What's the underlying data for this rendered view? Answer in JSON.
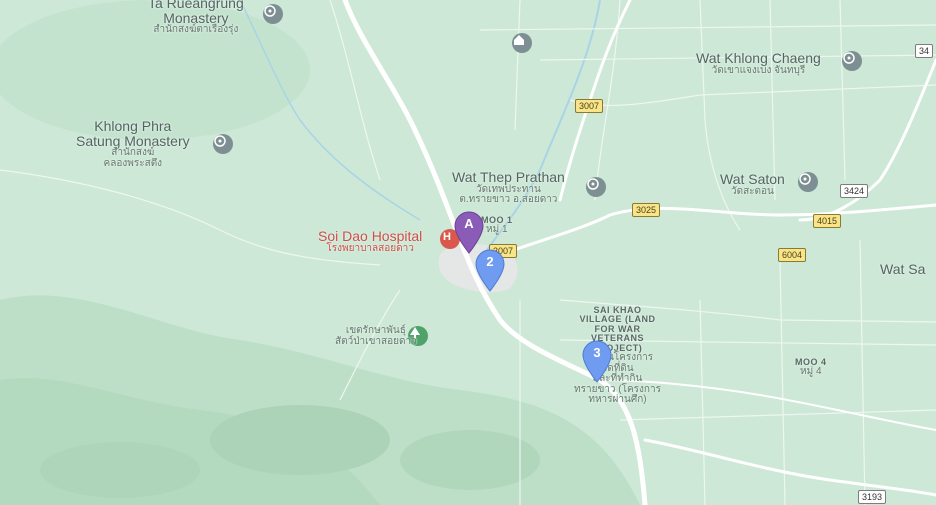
{
  "map": {
    "places": {
      "ta_rueangrung": {
        "en": "Ta Rueangrung",
        "en2": "Monastery",
        "th": "สำนักสงฆ์ตาเรืองรุ่ง"
      },
      "khlong_phra": {
        "en": "Khlong Phra",
        "en2": "Satung Monastery",
        "th": "สำนักสงฆ์",
        "th2": "คลองพระสตึง"
      },
      "wat_khlong_chaeng": {
        "en": "Wat Khlong Chaeng",
        "th": "วัดเขาแจงเบง จันทบุรี"
      },
      "wat_thep_prathan": {
        "en": "Wat Thep Prathan",
        "th": "วัดเทพประทาน",
        "th2": "ต.ทรายขาว อ.สอยดาว"
      },
      "wat_saton": {
        "en": "Wat Saton",
        "th": "วัดสะตอน"
      },
      "wat_sa": {
        "en": "Wat Sa"
      },
      "moo1": {
        "en": "MOO 1",
        "th": "หมู่ 1"
      },
      "soi_dao_hospital": {
        "en": "Soi Dao Hospital",
        "th": "โรงพยาบาลสอยดาว"
      },
      "wildlife": {
        "th": "เขตรักษาพันธุ์",
        "th2": "สัตว์ป่าเขาสอยดาว"
      },
      "sai_khao": {
        "en": "SAI KHAO",
        "en2": "VILLAGE (LAND",
        "en3": "FOR WAR",
        "en4": "VETERANS",
        "en5": "PROJECT)",
        "th": "หมู่บ้านโครงการ",
        "th2": "จัดที่ดิน",
        "th3": "และที่ทำกิน",
        "th4": "ทรายขาว (โครงการ",
        "th5": "ทหารผ่านศึก)"
      },
      "moo4": {
        "en": "MOO 4",
        "th": "หมู่ 4"
      }
    },
    "shields": {
      "r3007a": "3007",
      "r3007b": "3007",
      "r3025": "3025",
      "r3424": "3424",
      "r4015": "4015",
      "r6004": "6004",
      "r3193": "3193",
      "r34": "34"
    },
    "markers": {
      "a": "A",
      "m2": "2",
      "m3": "3"
    },
    "colors": {
      "land": "#cfe9d7",
      "forest": "#b9dfc6",
      "road_major": "#ffffff",
      "marker_a": "#8a5cb8",
      "marker_blue": "#6f9cf0",
      "hospital_red": "#d9574b"
    }
  }
}
